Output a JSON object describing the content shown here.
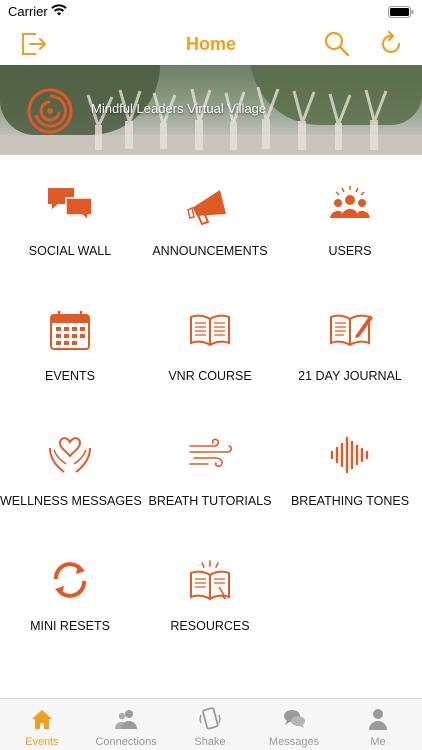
{
  "status_bar": {
    "carrier": "Carrier"
  },
  "nav": {
    "title": "Home"
  },
  "banner": {
    "org_name": "Mindful Leaders Virtual Village"
  },
  "colors": {
    "accent": "#f0a020",
    "icon": "#e05a25",
    "inactive": "#9a9a9a"
  },
  "tiles": [
    {
      "label": "SOCIAL WALL",
      "icon": "chat-bubbles-icon"
    },
    {
      "label": "ANNOUNCEMENTS",
      "icon": "megaphone-icon"
    },
    {
      "label": "USERS",
      "icon": "users-icon"
    },
    {
      "label": "EVENTS",
      "icon": "calendar-icon"
    },
    {
      "label": "VNR COURSE",
      "icon": "open-book-icon"
    },
    {
      "label": "21 DAY JOURNAL",
      "icon": "journal-icon"
    },
    {
      "label": "WELLNESS MESSAGES",
      "icon": "hands-heart-icon"
    },
    {
      "label": "BREATH TUTORIALS",
      "icon": "wind-icon"
    },
    {
      "label": "BREATHING TONES",
      "icon": "sound-wave-icon"
    },
    {
      "label": "MINI RESETS",
      "icon": "refresh-arrows-icon"
    },
    {
      "label": "RESOURCES",
      "icon": "reading-book-icon"
    }
  ],
  "tabs": [
    {
      "label": "Events",
      "icon": "home-icon",
      "active": true
    },
    {
      "label": "Connections",
      "icon": "connections-icon",
      "active": false
    },
    {
      "label": "Shake",
      "icon": "shake-phone-icon",
      "active": false
    },
    {
      "label": "Messages",
      "icon": "messages-icon",
      "active": false
    },
    {
      "label": "Me",
      "icon": "person-icon",
      "active": false
    }
  ]
}
